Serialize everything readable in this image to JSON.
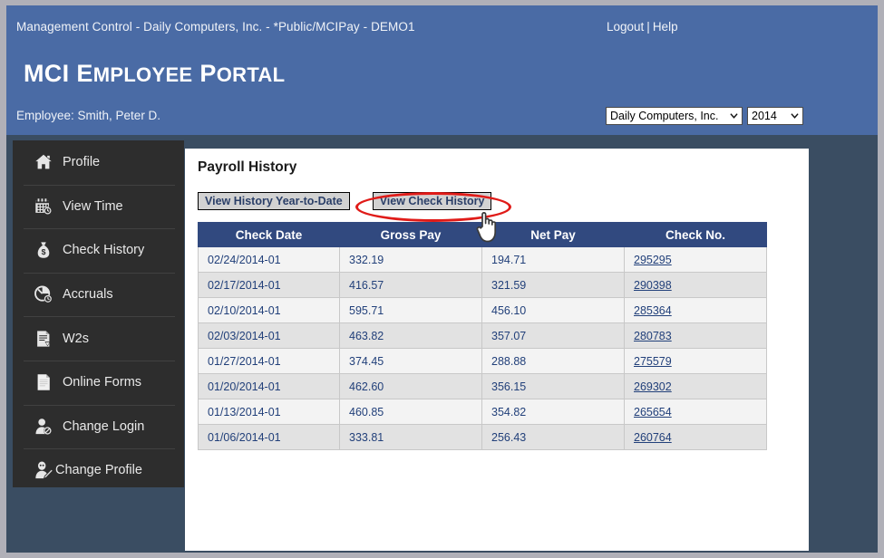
{
  "window": {
    "breadcrumb": "Management Control - Daily Computers, Inc. - *Public/MCIPay - DEMO1",
    "logout_label": "Logout",
    "links_separator": "|",
    "help_label": "Help"
  },
  "header": {
    "title_main": "MCI",
    "title_word2": "E",
    "title_word2_rest": "MPLOYEE",
    "title_word3": "P",
    "title_word3_rest": "ORTAL",
    "title_full": "MCI EMPLOYEE PORTAL",
    "employee_label": "Employee: Smith, Peter D.",
    "company_select": "Daily Computers, Inc.",
    "year_select": "2014",
    "company_options": [
      "Daily Computers, Inc."
    ],
    "year_options": [
      "2014"
    ]
  },
  "sidebar": {
    "items": [
      {
        "label": "Profile",
        "icon": "home-icon"
      },
      {
        "label": "View Time",
        "icon": "calendar-clock-icon"
      },
      {
        "label": "Check History",
        "icon": "money-bag-icon"
      },
      {
        "label": "Accruals",
        "icon": "clock-pie-icon"
      },
      {
        "label": "W2s",
        "icon": "document-form-icon"
      },
      {
        "label": "Online Forms",
        "icon": "page-icon"
      },
      {
        "label": "Change Login",
        "icon": "user-edit-icon"
      },
      {
        "label": "Change Profile",
        "icon": "user-pencil-icon"
      }
    ]
  },
  "main": {
    "page_title": "Payroll History",
    "buttons": [
      {
        "label": "View History Year-to-Date",
        "highlighted": false
      },
      {
        "label": "View Check History",
        "highlighted": true
      }
    ],
    "table": {
      "columns": [
        "Check Date",
        "Gross Pay",
        "Net Pay",
        "Check No."
      ],
      "rows": [
        {
          "check_date": "02/24/2014-01",
          "gross_pay": "332.19",
          "net_pay": "194.71",
          "check_no": "295295"
        },
        {
          "check_date": "02/17/2014-01",
          "gross_pay": "416.57",
          "net_pay": "321.59",
          "check_no": "290398"
        },
        {
          "check_date": "02/10/2014-01",
          "gross_pay": "595.71",
          "net_pay": "456.10",
          "check_no": "285364"
        },
        {
          "check_date": "02/03/2014-01",
          "gross_pay": "463.82",
          "net_pay": "357.07",
          "check_no": "280783"
        },
        {
          "check_date": "01/27/2014-01",
          "gross_pay": "374.45",
          "net_pay": "288.88",
          "check_no": "275579"
        },
        {
          "check_date": "01/20/2014-01",
          "gross_pay": "462.60",
          "net_pay": "356.15",
          "check_no": "269302"
        },
        {
          "check_date": "01/13/2014-01",
          "gross_pay": "460.85",
          "net_pay": "354.82",
          "check_no": "265654"
        },
        {
          "check_date": "01/06/2014-01",
          "gross_pay": "333.81",
          "net_pay": "256.43",
          "check_no": "260764"
        }
      ]
    }
  },
  "annotation": {
    "shape": "red-ellipse-highlight",
    "target": "View Check History",
    "cursor": "hand-pointer-cursor"
  },
  "colors": {
    "header_blue": "#4a6ba5",
    "page_slate": "#3a4d62",
    "sidebar_dark": "#2d2d2d",
    "table_header": "#31497f",
    "link_blue": "#22407a",
    "annotation_red": "#e01b18",
    "button_face": "#d2d2d2"
  }
}
